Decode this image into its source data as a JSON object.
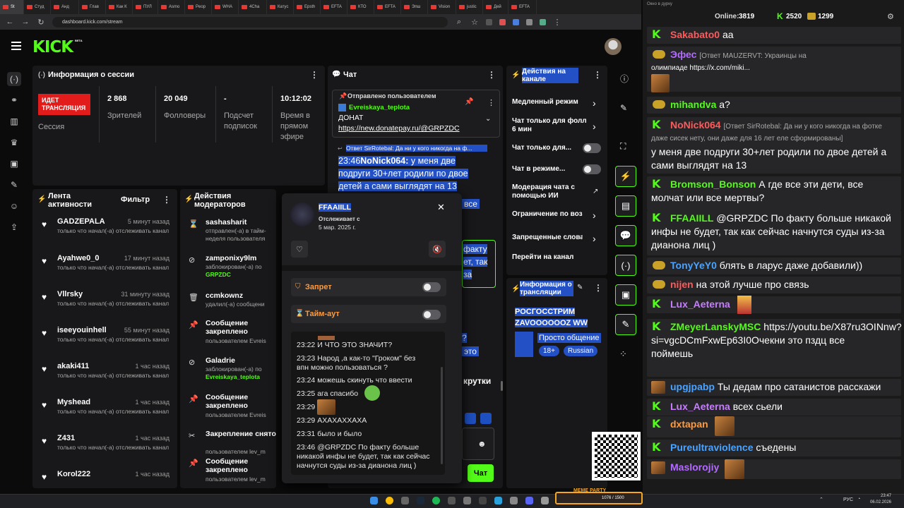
{
  "browser": {
    "tabs": [
      "St",
      "Студ",
      "Анд",
      "Глав",
      "Как К",
      "ПУЛ",
      "Asmo",
      "Peop",
      "WHA",
      "4Cha",
      "Катус",
      "Epsth",
      "EFTA",
      "КТО",
      "EFTA",
      "Эпш",
      "Vision",
      "justic",
      "Дей",
      "EFTA"
    ],
    "url": "dashboard.kick.com/stream"
  },
  "app": {
    "logo": "KICK",
    "beta": "BETA"
  },
  "session": {
    "title": "Информация о сессии",
    "live_badge": "ИДЕТ ТРАНСЛЯЦИЯ",
    "session_label": "Сессия",
    "stats": [
      {
        "value": "2 868",
        "label": "Зрителей"
      },
      {
        "value": "20 049",
        "label": "Фолловеры"
      },
      {
        "value": "-",
        "label": "Подсчет подписок"
      },
      {
        "value": "10:12:02",
        "label": "Время в прямом эфире"
      }
    ]
  },
  "activity": {
    "title": "Лента активности",
    "filter": "Фильтр",
    "desc": "только что начал(-а) отслеживать канал",
    "items": [
      {
        "name": "GADZEPALA",
        "time": "5 минут назад"
      },
      {
        "name": "Ayahwe0_0",
        "time": "17 минут назад"
      },
      {
        "name": "Vllrsky",
        "time": "31 минуту назад"
      },
      {
        "name": "iseeyouinhell",
        "time": "55 минут назад"
      },
      {
        "name": "akaki411",
        "time": "1 час назад"
      },
      {
        "name": "Myshead",
        "time": "1 час назад"
      },
      {
        "name": "Z431",
        "time": "1 час назад"
      },
      {
        "name": "Korol222",
        "time": "1 час назад"
      }
    ]
  },
  "mod": {
    "title": "Действия модераторов",
    "items": [
      {
        "name": "sashasharit",
        "l1": "отправлен(-а) в тайм-",
        "l2": "неделя пользователя"
      },
      {
        "name": "zamponixy9lm",
        "l1": "заблокирован(-а) по",
        "l2": "GRPZDC"
      },
      {
        "name": "ccmkownz",
        "l1": "удалил(-а) сообщени",
        "l2": ""
      },
      {
        "name": "Сообщение закреплено",
        "l1": "пользователем Evreis",
        "l2": ""
      },
      {
        "name": "Galadrie",
        "l1": "заблокирован(-а) по",
        "l2": "Evreiskaya_teplota"
      },
      {
        "name": "Сообщение закреплено",
        "l1": "пользователем Evreis",
        "l2": ""
      },
      {
        "name": "Закрепление снято",
        "l1": "пользователем lev_m",
        "l2": ""
      },
      {
        "name": "Сообщение закреплено",
        "l1": "пользователем lev_m",
        "l2": ""
      }
    ]
  },
  "chat": {
    "title": "Чат",
    "pinned_by": "Отправлено пользователем",
    "pinned_user": "Evreiskaya_teplota",
    "pinned_l1": "ДОНАТ",
    "pinned_l2": "https://new.donatepay.ru/@GRPZDC",
    "reply_to": "Ответ SirRotebal: Да ни у кого никогда на ф...",
    "msg_time": "23:46",
    "msg_user": "NoNick064:",
    "msg_l1": " у меня две",
    "msg_l2": "подруги 30+лет родили по двое",
    "msg_l3": "детей а сами выглядят на 13",
    "frag_vse": "все",
    "frag_fakty": "факту",
    "frag_tak": "ет, так",
    "frag_za": "за",
    "frag_q": "?",
    "frag_eto": "это",
    "frag_krutki": "крутки",
    "send": "Чат"
  },
  "popup": {
    "username": "FFAAIILL",
    "tracking": "Отслеживает с",
    "since": "5 мар. 2025 г.",
    "ban": "Запрет",
    "timeout": "Тайм-аут",
    "history": [
      "23:22 И ЧТО ЭТО ЗНАЧИТ?",
      "23:23 Народ ,а как-то \"Гроком\" без",
      "впн можно пользоваться ?",
      "23:24 можешь скинуть что ввести",
      "23:25 ага спасибо",
      "23:29",
      "23:29 АХАХАХХАХА",
      "23:31 было и было",
      "23:46 @GRPZDC По факту больше",
      "никакой инфы не будет, так как сейчас",
      "начнутся суды из-за дианона лиц )"
    ]
  },
  "channel": {
    "title": "Действия на канале",
    "items": [
      "Медленный режим",
      "Чат только для фолл 6 мин",
      "Чат только для...",
      "Чат в режиме...",
      "Модерация чата с помощью ИИ",
      "Ограничение по возр",
      "Запрещенные слова",
      "Перейти на канал"
    ],
    "stream_title": "Информация о трансляции",
    "stream_name_l1": "РОСГОССТРИМ",
    "stream_name_l2": "ZAVOOOOOOZ WW",
    "category": "Просто общение",
    "tags": [
      "18+",
      "Russian"
    ]
  },
  "overlay": {
    "window_title": "Окно в дурку",
    "online_label": "Online:",
    "online": "3819",
    "k_count": "2520",
    "gold_count": "1299",
    "messages": [
      {
        "user": "Sakabato0",
        "color": "#ff5a5a",
        "lines": [
          "аа"
        ]
      },
      {
        "user": "Эфес",
        "color": "#b36bff",
        "lines": [
          "[Ответ MAUZERVT: Украинцы на",
          "олимпиаде https://x.com/miki..."
        ]
      },
      {
        "user": "mihandva",
        "color": "#53fc18",
        "lines": [
          "а?"
        ]
      },
      {
        "user": "NoNick064",
        "color": "#ff5a5a",
        "lines": [
          "[Ответ SirRotebal: Да ни у кого никогда на фотке",
          "даже сисек нету, они даже для 16 лет еле сформированы]",
          "у меня две подруги 30+лет родили по двое детей а",
          "сами выглядят на 13"
        ]
      },
      {
        "user": "Bromson_Bonson",
        "color": "#53fc18",
        "lines": [
          "А где все эти дети, все",
          "молчат или все мертвы?"
        ]
      },
      {
        "user": "FFAAIILL",
        "color": "#53fc18",
        "lines": [
          "@GRPZDC По факту больше никакой",
          "инфы не будет, так как сейчас начнутся суды из-за",
          "дианона лиц )"
        ]
      },
      {
        "user": "TonyYeY0",
        "color": "#4aa3ff",
        "lines": [
          "блять в ларус даже добавили))"
        ]
      },
      {
        "user": "nijen",
        "color": "#ff5a5a",
        "lines": [
          "на этой лучше про связь"
        ]
      },
      {
        "user": "Lux_Aeterna",
        "color": "#c77dff",
        "lines": [
          ""
        ]
      },
      {
        "user": "ZMeyerLanskyMSC",
        "color": "#53fc18",
        "lines": [
          "https://youtu.be/X87ru3OINnw?",
          "si=vgcDCmFxwEp63I0Oчекни это пздц все",
          "поймешь"
        ]
      },
      {
        "user": "upgjpabp",
        "color": "#4aa3ff",
        "lines": [
          "Ты дедам про сатанистов расскажи"
        ]
      },
      {
        "user": "Lux_Aeterna",
        "color": "#c77dff",
        "lines": [
          "всех сьели"
        ]
      },
      {
        "user": "dxtapan",
        "color": "#ff9a3c",
        "lines": [
          ""
        ]
      },
      {
        "user": "Pureultraviolence",
        "color": "#4aa3ff",
        "lines": [
          "съедены"
        ]
      },
      {
        "user": "Maslorojiy",
        "color": "#b36bff",
        "lines": [
          ""
        ]
      }
    ]
  },
  "taskbar": {
    "lang": "РУС",
    "time": "23:47",
    "date": "06.02.2026",
    "meme_label": "MEME PARTY",
    "meme_count": "1076 / 1500"
  },
  "colors": {
    "brand": "#53fc18",
    "live": "#e21b1b",
    "highlight": "#2350c4"
  }
}
